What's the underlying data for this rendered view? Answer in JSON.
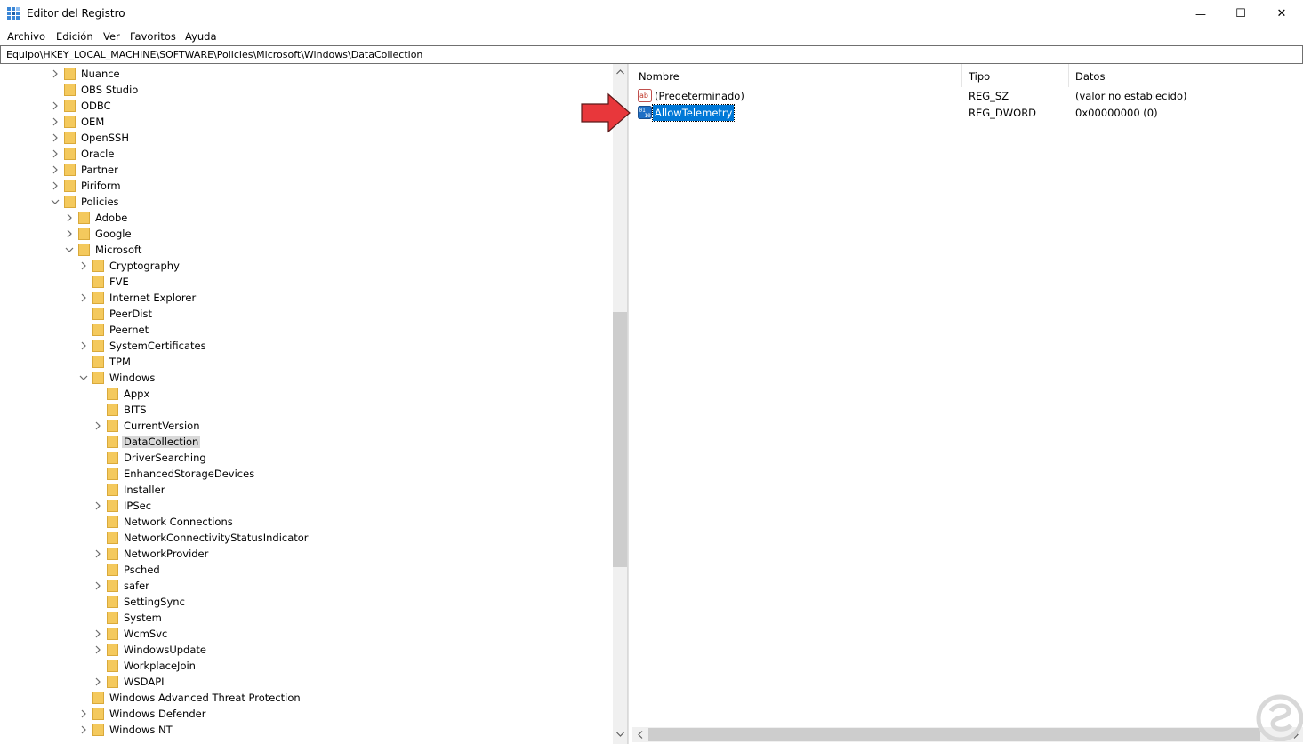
{
  "window": {
    "title": "Editor del Registro",
    "minimize_glyph": "—",
    "maximize_glyph": "☐",
    "close_glyph": "✕"
  },
  "menu": [
    "Archivo",
    "Edición",
    "Ver",
    "Favoritos",
    "Ayuda"
  ],
  "address": "Equipo\\HKEY_LOCAL_MACHINE\\SOFTWARE\\Policies\\Microsoft\\Windows\\DataCollection",
  "tree": [
    {
      "label": "Nuance",
      "level": 0,
      "expander": "collapsed"
    },
    {
      "label": "OBS Studio",
      "level": 0,
      "expander": "none"
    },
    {
      "label": "ODBC",
      "level": 0,
      "expander": "collapsed"
    },
    {
      "label": "OEM",
      "level": 0,
      "expander": "collapsed"
    },
    {
      "label": "OpenSSH",
      "level": 0,
      "expander": "collapsed"
    },
    {
      "label": "Oracle",
      "level": 0,
      "expander": "collapsed"
    },
    {
      "label": "Partner",
      "level": 0,
      "expander": "collapsed"
    },
    {
      "label": "Piriform",
      "level": 0,
      "expander": "collapsed"
    },
    {
      "label": "Policies",
      "level": 0,
      "expander": "expanded"
    },
    {
      "label": "Adobe",
      "level": 1,
      "expander": "collapsed"
    },
    {
      "label": "Google",
      "level": 1,
      "expander": "collapsed"
    },
    {
      "label": "Microsoft",
      "level": 1,
      "expander": "expanded"
    },
    {
      "label": "Cryptography",
      "level": 2,
      "expander": "collapsed"
    },
    {
      "label": "FVE",
      "level": 2,
      "expander": "none"
    },
    {
      "label": "Internet Explorer",
      "level": 2,
      "expander": "collapsed"
    },
    {
      "label": "PeerDist",
      "level": 2,
      "expander": "none"
    },
    {
      "label": "Peernet",
      "level": 2,
      "expander": "none"
    },
    {
      "label": "SystemCertificates",
      "level": 2,
      "expander": "collapsed"
    },
    {
      "label": "TPM",
      "level": 2,
      "expander": "none"
    },
    {
      "label": "Windows",
      "level": 2,
      "expander": "expanded"
    },
    {
      "label": "Appx",
      "level": 3,
      "expander": "none"
    },
    {
      "label": "BITS",
      "level": 3,
      "expander": "none"
    },
    {
      "label": "CurrentVersion",
      "level": 3,
      "expander": "collapsed"
    },
    {
      "label": "DataCollection",
      "level": 3,
      "expander": "none",
      "selected": true
    },
    {
      "label": "DriverSearching",
      "level": 3,
      "expander": "none"
    },
    {
      "label": "EnhancedStorageDevices",
      "level": 3,
      "expander": "none"
    },
    {
      "label": "Installer",
      "level": 3,
      "expander": "none"
    },
    {
      "label": "IPSec",
      "level": 3,
      "expander": "collapsed"
    },
    {
      "label": "Network Connections",
      "level": 3,
      "expander": "none"
    },
    {
      "label": "NetworkConnectivityStatusIndicator",
      "level": 3,
      "expander": "none"
    },
    {
      "label": "NetworkProvider",
      "level": 3,
      "expander": "collapsed"
    },
    {
      "label": "Psched",
      "level": 3,
      "expander": "none"
    },
    {
      "label": "safer",
      "level": 3,
      "expander": "collapsed"
    },
    {
      "label": "SettingSync",
      "level": 3,
      "expander": "none"
    },
    {
      "label": "System",
      "level": 3,
      "expander": "none"
    },
    {
      "label": "WcmSvc",
      "level": 3,
      "expander": "collapsed"
    },
    {
      "label": "WindowsUpdate",
      "level": 3,
      "expander": "collapsed"
    },
    {
      "label": "WorkplaceJoin",
      "level": 3,
      "expander": "none"
    },
    {
      "label": "WSDAPI",
      "level": 3,
      "expander": "collapsed"
    },
    {
      "label": "Windows Advanced Threat Protection",
      "level": 2,
      "expander": "none"
    },
    {
      "label": "Windows Defender",
      "level": 2,
      "expander": "collapsed"
    },
    {
      "label": "Windows NT",
      "level": 2,
      "expander": "collapsed"
    }
  ],
  "list": {
    "columns": [
      "Nombre",
      "Tipo",
      "Datos"
    ],
    "rows": [
      {
        "name": "(Predeterminado)",
        "type": "REG_SZ",
        "data": "(valor no establecido)",
        "icon": "string-value-icon",
        "selected": false
      },
      {
        "name": "AllowTelemetry",
        "type": "REG_DWORD",
        "data": "0x00000000 (0)",
        "icon": "binary-value-icon",
        "selected": true
      }
    ]
  },
  "colors": {
    "folder": "#f4c95d",
    "selection_blue": "#0078d7",
    "tree_selection": "#d9d9d9",
    "arrow_red": "#e8373b"
  },
  "icons": {
    "app": "registry-editor-icon",
    "pointer": "red-arrow-icon",
    "watermark": "watermark-logo-icon"
  }
}
